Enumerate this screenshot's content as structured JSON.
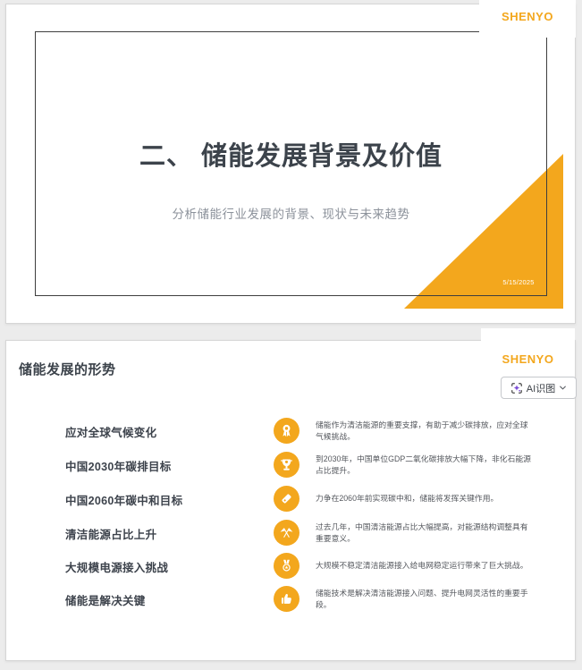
{
  "colors": {
    "accent": "#f3a71d",
    "title": "#3c434b",
    "subtitle": "#8c929b",
    "desc": "#55585e",
    "sparkle": "#7d4fd8"
  },
  "slide1": {
    "logo": "SHENYO",
    "title": "二、 储能发展背景及价值",
    "subtitle": "分析储能行业发展的背景、现状与未来趋势",
    "date": "5/15/2025"
  },
  "slide2": {
    "logo": "SHENYO",
    "title": "储能发展的形势",
    "ai_button": {
      "label": "AI识图",
      "icon": "scan-sparkle-icon",
      "chevron": "chevron-down-icon"
    },
    "items": [
      {
        "label": "应对全球气候变化",
        "icon": "award-rosette-icon",
        "desc": "储能作为清洁能源的重要支撑，有助于减少碳排放，应对全球气候挑战。"
      },
      {
        "label": "中国2030年碳排目标",
        "icon": "trophy-icon",
        "desc": "到2030年，中国单位GDP二氧化碳排放大幅下降，非化石能源占比提升。"
      },
      {
        "label": "中国2060年碳中和目标",
        "icon": "tag-icon",
        "desc": "力争在2060年前实现碳中和，储能将发挥关键作用。"
      },
      {
        "label": "清洁能源占比上升",
        "icon": "crossed-flags-icon",
        "desc": "过去几年，中国清洁能源占比大幅提高，对能源结构调整具有重要意义。"
      },
      {
        "label": "大规模电源接入挑战",
        "icon": "medal-icon",
        "desc": "大规模不稳定清洁能源接入给电网稳定运行带来了巨大挑战。"
      },
      {
        "label": "储能是解决关键",
        "icon": "thumbs-up-icon",
        "desc": "储能技术是解决清洁能源接入问题、提升电网灵活性的重要手段。"
      }
    ]
  }
}
